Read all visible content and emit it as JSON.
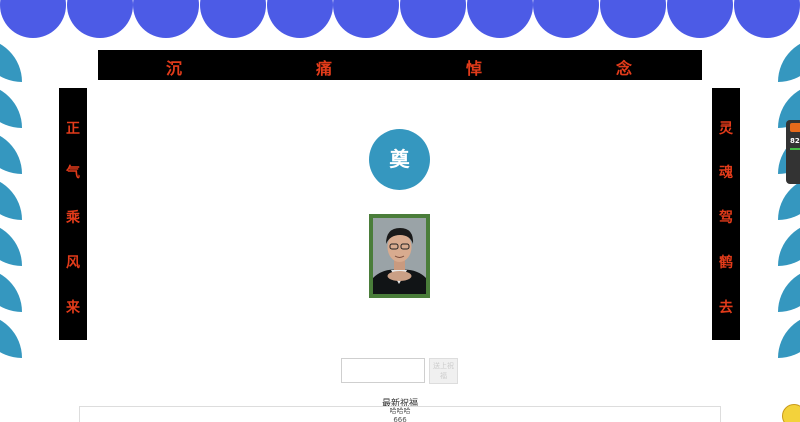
{
  "banner": {
    "chars": [
      "沉",
      "痛",
      "悼",
      "念"
    ]
  },
  "couplet_left": {
    "chars": [
      "正",
      "气",
      "乘",
      "风",
      "来"
    ]
  },
  "couplet_right": {
    "chars": [
      "灵",
      "魂",
      "驾",
      "鹤",
      "去"
    ]
  },
  "memorial": {
    "symbol": "奠"
  },
  "wish_form": {
    "input_value": "",
    "submit_label": "送上祝福"
  },
  "wishes": {
    "title": "最新祝福",
    "items": [
      "哈哈哈",
      "666"
    ]
  },
  "float_widget": {
    "number": "82"
  },
  "colors": {
    "top_scallop": "#4c5be6",
    "side_scallop": "#3597bf",
    "couplet_bg": "#000000",
    "couplet_text": "#e23b1a",
    "circle": "#3597bf",
    "portrait_frame": "#4a7d3a"
  }
}
